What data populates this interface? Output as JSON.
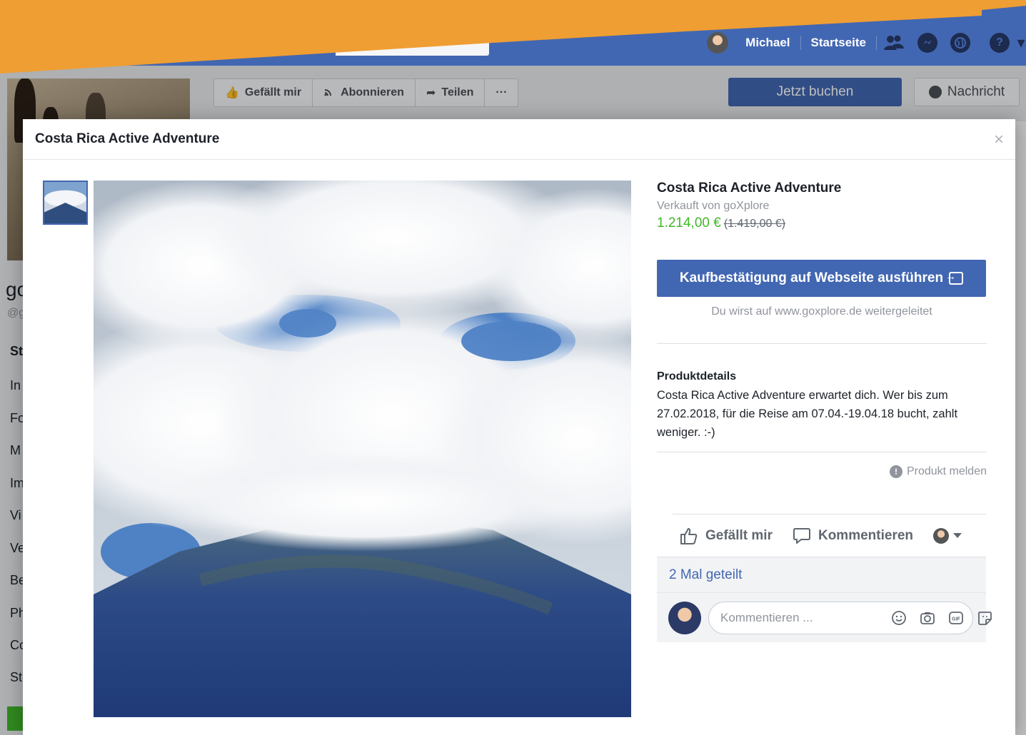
{
  "colors": {
    "accent": "#4267b2",
    "price": "#42b72a",
    "banner": "#ef9e33"
  },
  "topnav": {
    "user_name": "Michael",
    "home_label": "Startseite"
  },
  "page_actions": {
    "like_label": "Gefällt mir",
    "follow_label": "Abonnieren",
    "share_label": "Teilen",
    "more_label": "···",
    "book_label": "Jetzt buchen",
    "message_label": "Nachricht"
  },
  "left_nav": {
    "page_name_partial": "go",
    "handle_partial": "@g",
    "items": [
      "St",
      "In",
      "Fo",
      "M",
      "Im",
      "Vi",
      "Ve",
      "Be",
      "Ph",
      "Co",
      "St"
    ]
  },
  "modal": {
    "title": "Costa Rica Active Adventure",
    "close_glyph": "×",
    "product": {
      "name": "Costa Rica Active Adventure",
      "seller": "Verkauft von goXplore",
      "price": "1.214,00 €",
      "old_price": "(1.419,00 €)",
      "buy_label": "Kaufbestätigung auf Webseite ausführen",
      "redirect_note": "Du wirst auf www.goxplore.de weitergeleitet",
      "details_title": "Produktdetails",
      "details_text": "Costa Rica Active Adventure erwartet dich. Wer bis zum 27.02.2018, für die Reise am 07.04.-19.04.18 bucht, zahlt weniger. :-)",
      "report_label": "Produkt melden"
    },
    "ufi": {
      "like_label": "Gefällt mir",
      "comment_label": "Kommentieren",
      "shares_label": "2 Mal geteilt",
      "comment_placeholder": "Kommentieren ..."
    }
  }
}
